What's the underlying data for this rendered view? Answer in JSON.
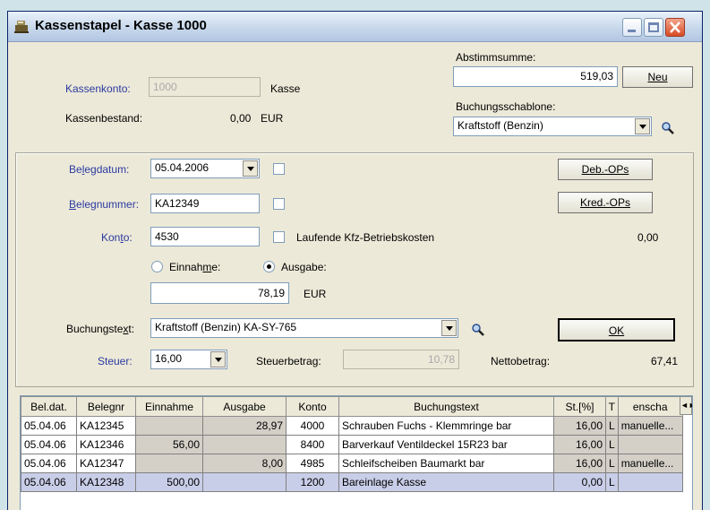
{
  "window": {
    "title": "Kassenstapel - Kasse 1000"
  },
  "header": {
    "kassenkonto_label": "Kassenkonto:",
    "kassenkonto_value": "1000",
    "kassenkonto_name": "Kasse",
    "kassenbestand_label": "Kassenbestand:",
    "kassenbestand_value": "0,00",
    "kassenbestand_currency": "EUR",
    "abstimmsumme_label": "Abstimmsumme:",
    "abstimmsumme_value": "519,03",
    "neu_button": "Neu",
    "schablone_label": "Buchungsschablone:",
    "schablone_value": "Kraftstoff (Benzin)"
  },
  "form": {
    "belegdatum_label": "Belegdatum:",
    "belegdatum_value": "05.04.2006",
    "belegnummer_label": "Belegnummer:",
    "belegnummer_value": "KA12349",
    "konto_label": "Konto:",
    "konto_value": "4530",
    "konto_name": "Laufende Kfz-Betriebskosten",
    "konto_saldo": "0,00",
    "deb_ops_button": "Deb.-OPs",
    "kred_ops_button": "Kred.-OPs",
    "einnahme_label": "Einnahme:",
    "ausgabe_label": "Ausgabe:",
    "betrag_value": "78,19",
    "betrag_currency": "EUR",
    "buchungstext_label": "Buchungstext:",
    "buchungstext_value": "Kraftstoff (Benzin) KA-SY-765",
    "ok_button": "OK",
    "steuer_label": "Steuer:",
    "steuer_value": "16,00",
    "steuerbetrag_label": "Steuerbetrag:",
    "steuerbetrag_value": "10,78",
    "nettobetrag_label": "Nettobetrag:",
    "nettobetrag_value": "67,41"
  },
  "grid": {
    "columns": [
      "Bel.dat.",
      "Belegnr",
      "Einnahme",
      "Ausgabe",
      "Konto",
      "Buchungstext",
      "St.[%]",
      "T",
      "enscha"
    ],
    "rows": [
      [
        "05.04.06",
        "KA12345",
        "",
        "28,97",
        "4000",
        "Schrauben Fuchs - Klemmringe bar",
        "16,00",
        "L",
        "manuelle..."
      ],
      [
        "05.04.06",
        "KA12346",
        "56,00",
        "",
        "8400",
        "Barverkauf Ventildeckel 15R23 bar",
        "16,00",
        "L",
        ""
      ],
      [
        "05.04.06",
        "KA12347",
        "",
        "8,00",
        "4985",
        "Schleifscheiben Baumarkt bar",
        "16,00",
        "L",
        "manuelle..."
      ],
      [
        "05.04.06",
        "KA12348",
        "500,00",
        "",
        "1200",
        "Bareinlage Kasse",
        "0,00",
        "L",
        ""
      ]
    ]
  },
  "colors": {
    "label_blue": "#2b3aa1",
    "selected_row": "#c9cee8",
    "window_bg": "#ece9d8"
  }
}
